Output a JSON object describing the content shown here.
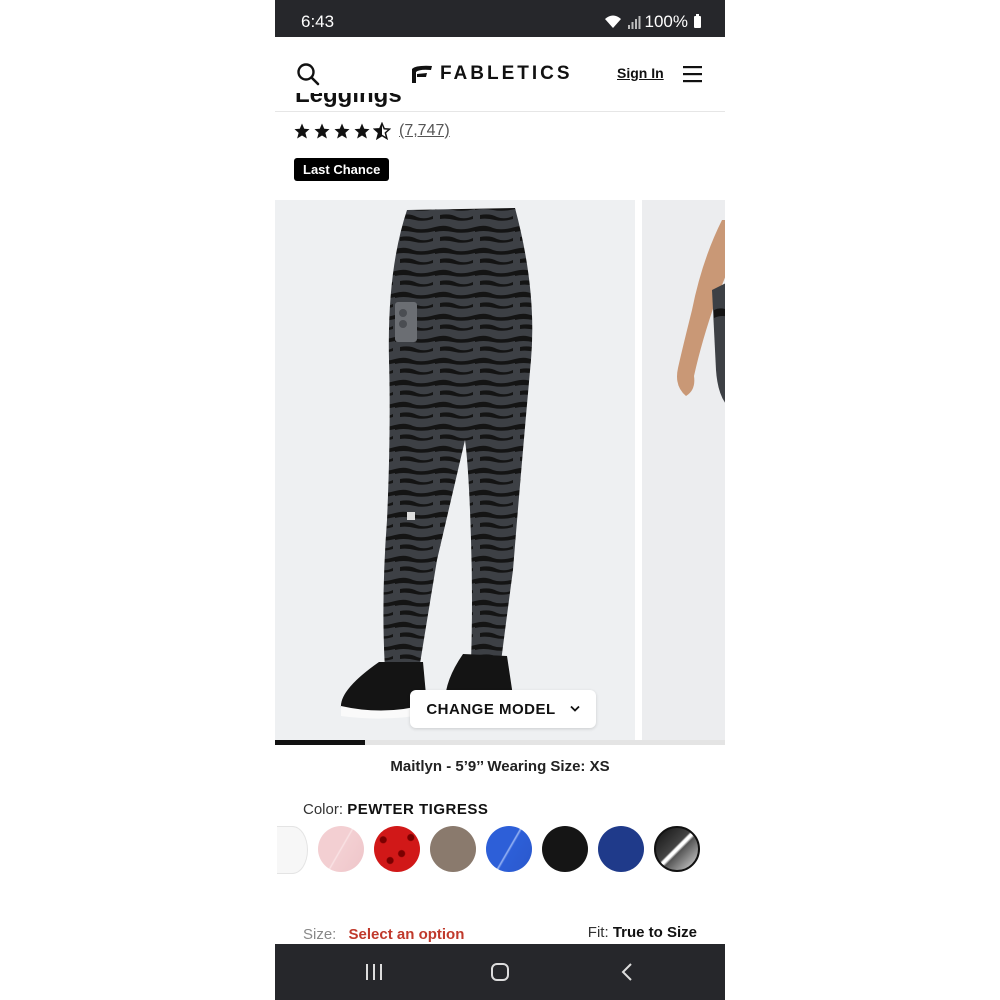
{
  "status": {
    "time": "6:43",
    "battery": "100%"
  },
  "header": {
    "brand": "FABLETICS",
    "sign_in": "Sign In"
  },
  "product": {
    "title_partial": "Leggings",
    "review_count": "(7,747)",
    "rating": 4.5,
    "badge": "Last Chance"
  },
  "gallery": {
    "change_model_label": "CHANGE MODEL",
    "progress": 0.2,
    "model_info": "Maitlyn - 5’9’’ Wearing Size: XS"
  },
  "color": {
    "label": "Color:",
    "selected": "PEWTER TIGRESS",
    "swatches": [
      "white",
      "light-pink",
      "red-print",
      "taupe",
      "bright-blue",
      "black",
      "navy",
      "pewter-tigress"
    ]
  },
  "size": {
    "label": "Size:",
    "placeholder": "Select an option"
  },
  "fit": {
    "label": "Fit:",
    "value": "True to Size"
  },
  "colors": {
    "accent_red": "#c0392b",
    "status_bar": "#26272b"
  }
}
